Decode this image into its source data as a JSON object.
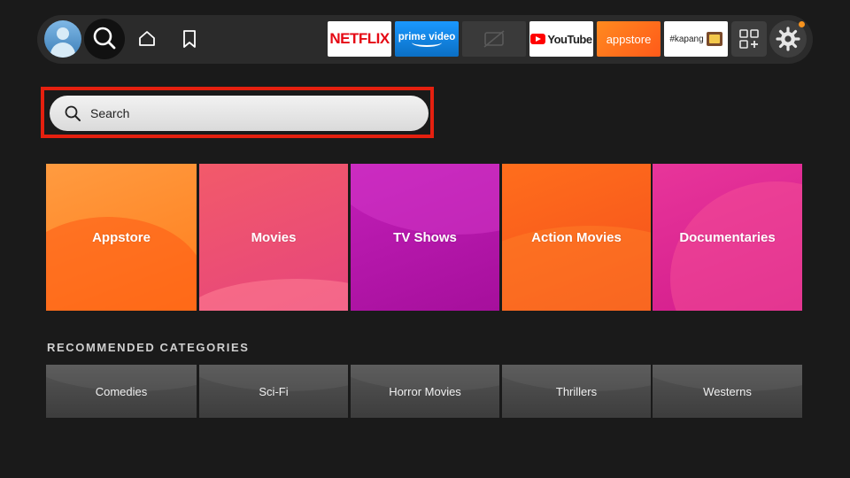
{
  "nav": {
    "apps": [
      {
        "name": "Netflix",
        "label": "NETFLIX"
      },
      {
        "name": "Prime Video",
        "label": "prime video"
      },
      {
        "name": "Hidden app",
        "label": ""
      },
      {
        "name": "YouTube",
        "label": "YouTube"
      },
      {
        "name": "Appstore",
        "label": "appstore"
      },
      {
        "name": "Kapang",
        "label": "#kapang"
      }
    ],
    "icons": [
      "profile-avatar",
      "search-icon",
      "home-icon",
      "watchlist-icon",
      "app-library-icon",
      "gear-icon"
    ],
    "notification_color": "#f7931e"
  },
  "search": {
    "label": "Search",
    "highlight_color": "#e5200f"
  },
  "tiles": [
    {
      "label": "Appstore",
      "colors": [
        "#ff9a3c",
        "#ff7a1a"
      ]
    },
    {
      "label": "Movies",
      "colors": [
        "#f0566c",
        "#e84a7a"
      ]
    },
    {
      "label": "TV Shows",
      "colors": [
        "#c01db5",
        "#a80f9e"
      ]
    },
    {
      "label": "Action Movies",
      "colors": [
        "#ff6a1a",
        "#f5531c"
      ]
    },
    {
      "label": "Documentaries",
      "colors": [
        "#e6309a",
        "#d41e8c"
      ]
    }
  ],
  "recommended": {
    "title": "RECOMMENDED CATEGORIES",
    "items": [
      "Comedies",
      "Sci-Fi",
      "Horror Movies",
      "Thrillers",
      "Westerns"
    ]
  }
}
